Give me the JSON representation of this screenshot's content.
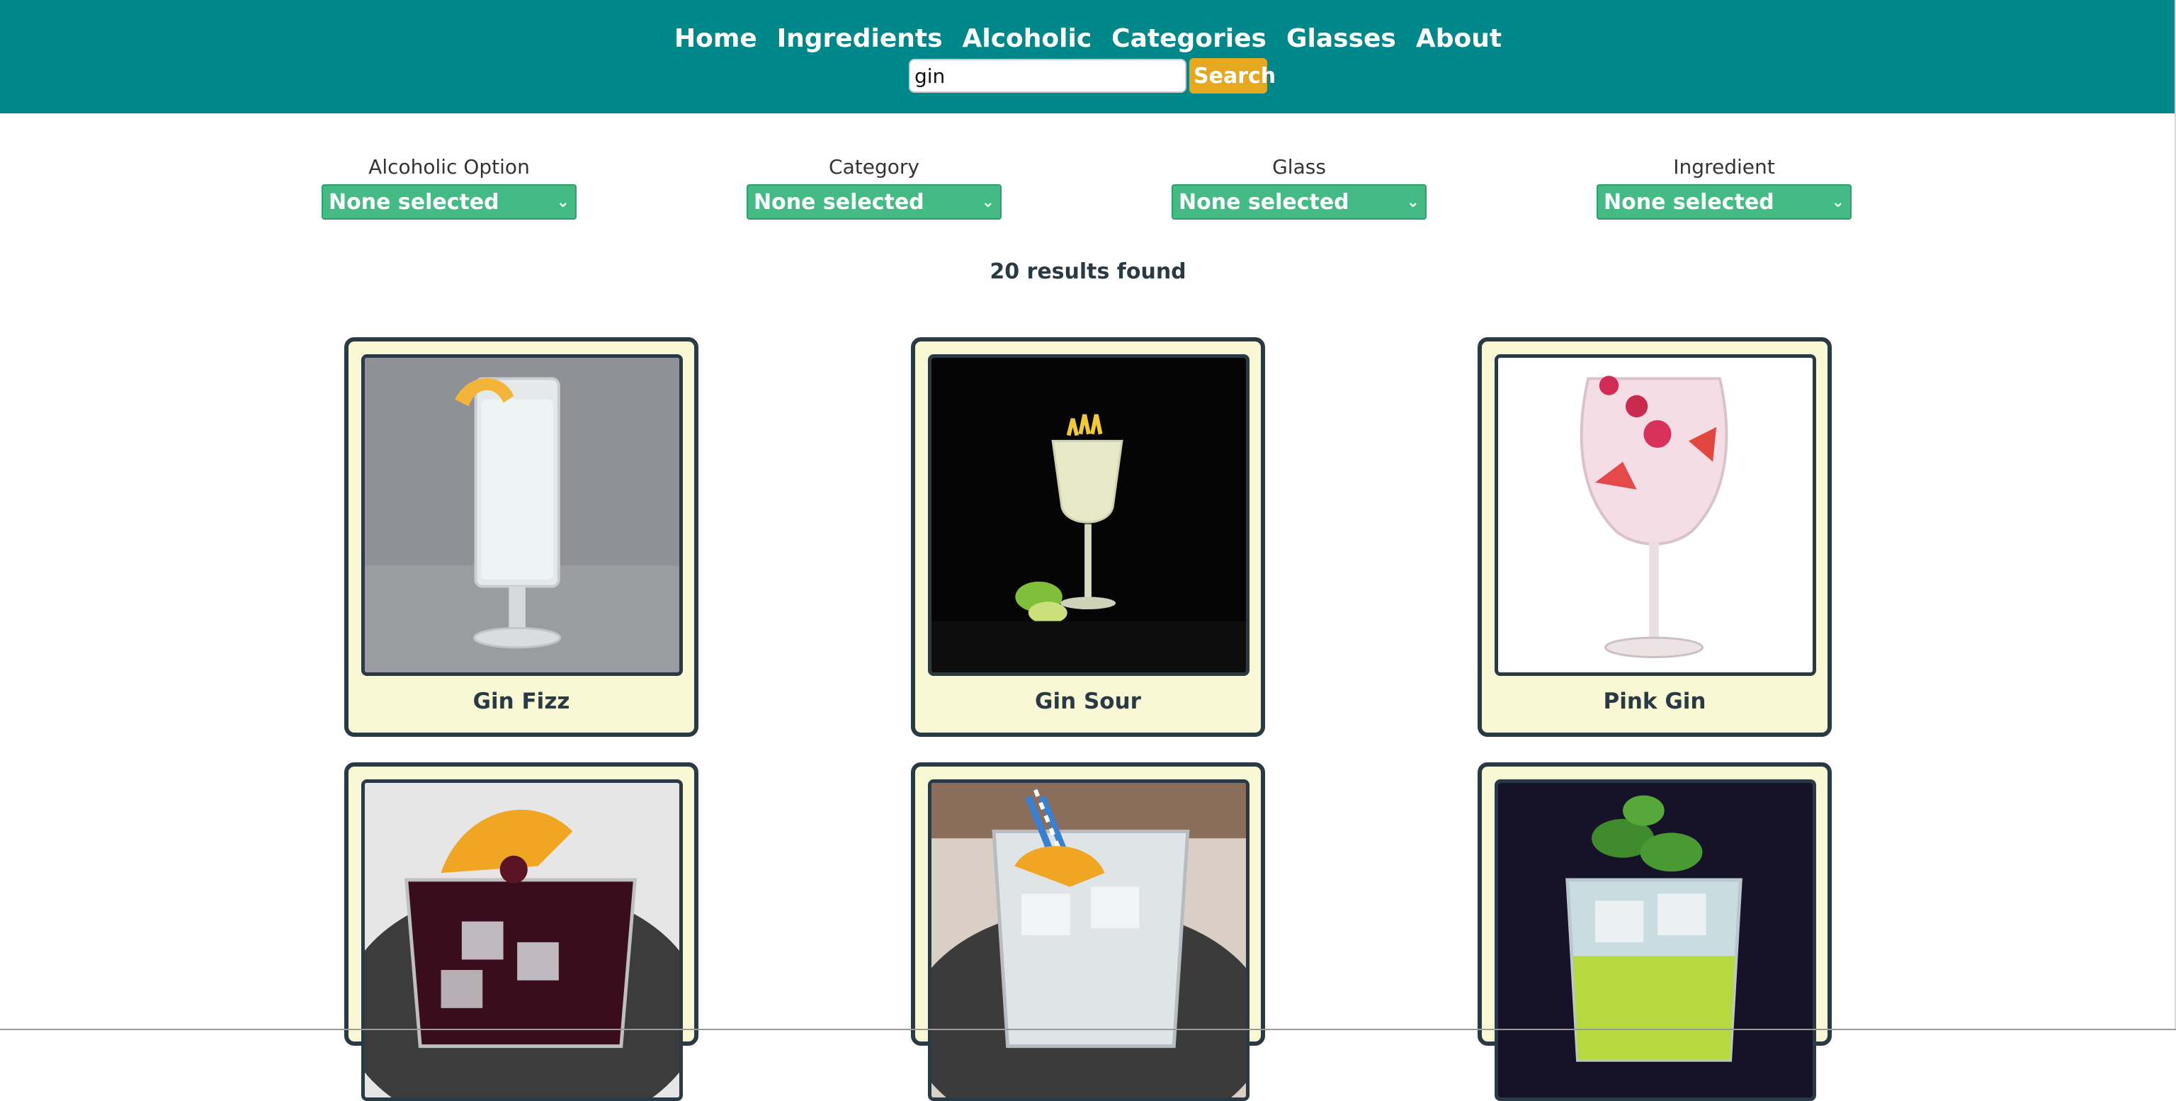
{
  "nav": {
    "items": [
      "Home",
      "Ingredients",
      "Alcoholic",
      "Categories",
      "Glasses",
      "About"
    ]
  },
  "search": {
    "value": "gin",
    "button_label": "Search"
  },
  "filters": [
    {
      "label": "Alcoholic Option",
      "value": "None selected"
    },
    {
      "label": "Category",
      "value": "None selected"
    },
    {
      "label": "Glass",
      "value": "None selected"
    },
    {
      "label": "Ingredient",
      "value": "None selected"
    }
  ],
  "results_text": "20 results found",
  "cards": [
    {
      "name": "Gin Fizz"
    },
    {
      "name": "Gin Sour"
    },
    {
      "name": "Pink Gin"
    },
    {
      "name": ""
    },
    {
      "name": ""
    },
    {
      "name": ""
    }
  ],
  "colors": {
    "header": "#00878a",
    "search_button": "#e6a81e",
    "select": "#44bb84",
    "card_bg": "#f9f8d5",
    "card_border": "#2a3a44"
  }
}
